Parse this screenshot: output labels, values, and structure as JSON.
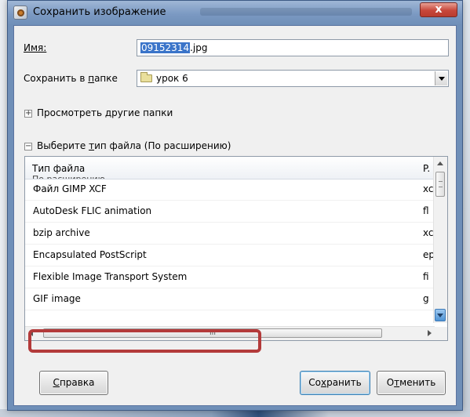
{
  "dialog": {
    "title": "Сохранить изображение",
    "close_label": "x"
  },
  "name_row": {
    "label": "Имя:",
    "value_selected": "09152314",
    "value_rest": ".jpg"
  },
  "folder_row": {
    "label_prefix": "Сохранить в ",
    "label_mnemonic": "п",
    "label_suffix": "апке",
    "value": "урок 6"
  },
  "browse_folders": {
    "expander": "+",
    "label": "Просмотреть другие папки"
  },
  "file_type": {
    "expander": "−",
    "label_prefix": "Выберите ",
    "label_mnemonic": "т",
    "label_suffix": "ип файла (По расширению)"
  },
  "file_list": {
    "col_type": "Тип файла",
    "col_ext": "P.",
    "partial_top_row": "По расширению",
    "rows": [
      {
        "name": "Файл GIMP XCF",
        "ext": "xc"
      },
      {
        "name": "AutoDesk FLIC animation",
        "ext": "fl"
      },
      {
        "name": "bzip archive",
        "ext": "xc"
      },
      {
        "name": "Encapsulated PostScript",
        "ext": "ep"
      },
      {
        "name": "Flexible Image Transport System",
        "ext": "fi"
      },
      {
        "name": "GIF image",
        "ext": "g"
      }
    ],
    "h_scroll_grip": "III"
  },
  "buttons": {
    "help_mnemonic": "С",
    "help_rest": "правка",
    "save_prefix": "Со",
    "save_mnemonic": "х",
    "save_suffix": "ранить",
    "cancel_prefix": "О",
    "cancel_mnemonic": "т",
    "cancel_suffix": "менить"
  },
  "colors": {
    "highlight": "#b33a3a",
    "selection": "#3a74c9"
  }
}
